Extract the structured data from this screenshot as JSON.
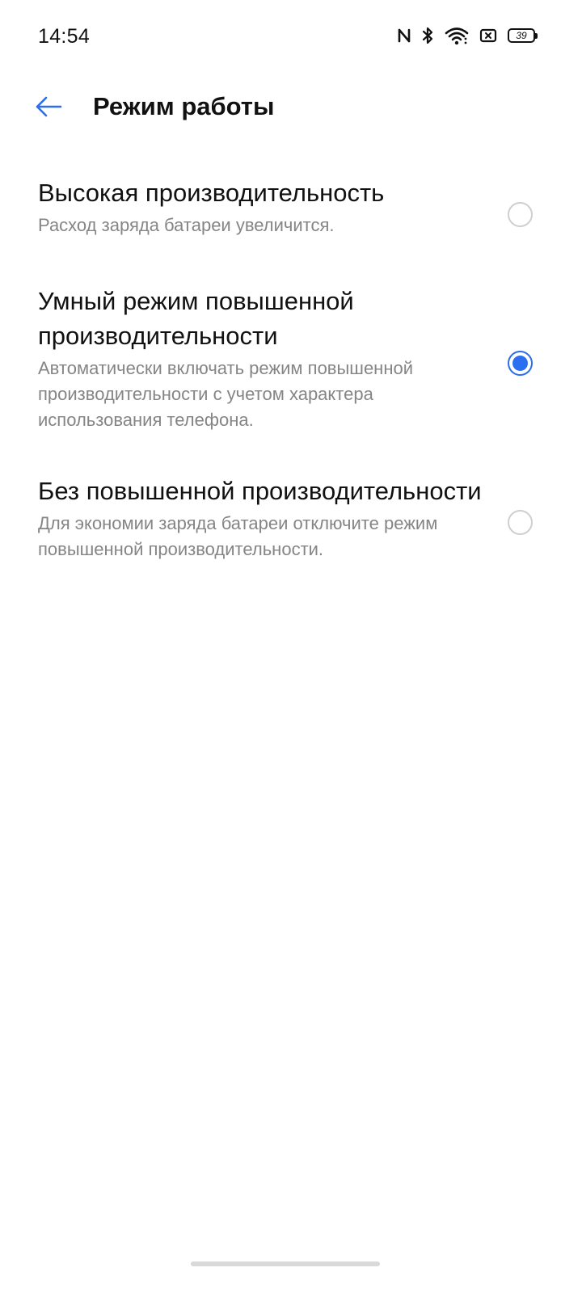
{
  "status_bar": {
    "time": "14:54",
    "icons": [
      "nfc-icon",
      "bluetooth-icon",
      "wifi-icon",
      "sim-off-icon",
      "battery-icon"
    ],
    "battery_level": "39"
  },
  "header": {
    "back_icon": "arrow-left-icon",
    "title": "Режим работы"
  },
  "accent_color": "#2a6ff0",
  "options": [
    {
      "title": "Высокая производительность",
      "description": "Расход заряда батареи увеличится.",
      "selected": false
    },
    {
      "title": "Умный режим повышенной производительности",
      "description": "Автоматически включать режим повышенной производительности с учетом характера использования телефона.",
      "selected": true
    },
    {
      "title": "Без повышенной производительности",
      "description": "Для экономии заряда батареи отключите режим повышенной производительности.",
      "selected": false
    }
  ]
}
